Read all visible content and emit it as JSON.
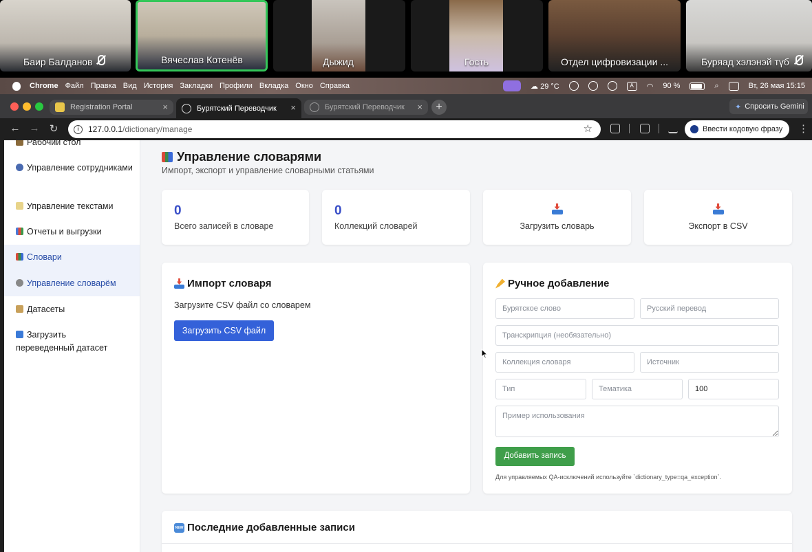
{
  "video_call": {
    "participants": [
      {
        "name": "Баир Балданов",
        "muted": true,
        "active": false
      },
      {
        "name": "Вячеслав Котенёв",
        "muted": false,
        "active": true
      },
      {
        "name": "Дыжид",
        "muted": false,
        "active": false
      },
      {
        "name": "Гость",
        "muted": false,
        "active": false
      },
      {
        "name": "Отдел цифровизации ...",
        "muted": false,
        "active": false
      },
      {
        "name": "Буряад хэлэнэй түб",
        "muted": true,
        "active": false
      }
    ]
  },
  "macos_menubar": {
    "app": "Chrome",
    "menus": [
      "Файл",
      "Правка",
      "Вид",
      "История",
      "Закладки",
      "Профили",
      "Вкладка",
      "Окно",
      "Справка"
    ],
    "weather": "29 °C",
    "battery": "90 %",
    "datetime": "Вт, 26 мая  15:15"
  },
  "browser": {
    "tabs": [
      {
        "title": "Registration Portal",
        "state": "inactive"
      },
      {
        "title": "Бурятский Переводчик",
        "state": "active"
      },
      {
        "title": "Бурятский Переводчик",
        "state": "inactive"
      }
    ],
    "gemini_label": "Спросить Gemini",
    "url_host": "127.0.0.1",
    "url_path": "/dictionary/manage",
    "passkey_label": "Ввести кодовую фразу"
  },
  "sidebar": {
    "items": [
      {
        "label": "Рабочий стол",
        "active": false
      },
      {
        "label": "Управление сотрудниками",
        "active": false
      },
      {
        "label": "Управление текстами",
        "active": false
      },
      {
        "label": "Отчеты и выгрузки",
        "active": false
      },
      {
        "label": "Словари",
        "active": true
      },
      {
        "label": "Управление словарём",
        "active": true
      },
      {
        "label": "Датасеты",
        "active": false
      },
      {
        "label": "Загрузить переведенный датасет",
        "active": false
      }
    ]
  },
  "header": {
    "title": "Управление словарями",
    "subtitle": "Импорт, экспорт и управление словарными статьями"
  },
  "stats": {
    "total_entries_value": "0",
    "total_entries_label": "Всего записей в словаре",
    "collections_value": "0",
    "collections_label": "Коллекций словарей"
  },
  "actions": {
    "upload_label": "Загрузить словарь",
    "export_label": "Экспорт в CSV"
  },
  "import_section": {
    "title": "Импорт словаря",
    "description": "Загрузите CSV файл со словарем",
    "button": "Загрузить CSV файл"
  },
  "manual_section": {
    "title": "Ручное добавление",
    "fields": {
      "buryat_word": {
        "placeholder": "Бурятское слово",
        "value": ""
      },
      "russian_translation": {
        "placeholder": "Русский перевод",
        "value": ""
      },
      "transcription": {
        "placeholder": "Транскрипция (необязательно)",
        "value": ""
      },
      "collection": {
        "placeholder": "Коллекция словаря",
        "value": ""
      },
      "source": {
        "placeholder": "Источник",
        "value": ""
      },
      "type": {
        "placeholder": "Тип",
        "value": ""
      },
      "topic": {
        "placeholder": "Тематика",
        "value": ""
      },
      "number": {
        "value": "100"
      },
      "example": {
        "placeholder": "Пример использования",
        "value": ""
      }
    },
    "submit": "Добавить запись",
    "note": "Для управляемых QA-исключений используйте `dictionary_type=qa_exception`."
  },
  "recent_section": {
    "title": "Последние добавленные записи"
  },
  "colors": {
    "primary": "#3461d9",
    "success": "#3f9e4a",
    "stat_number": "#3a4fc8",
    "active_speaker": "#34c759"
  }
}
